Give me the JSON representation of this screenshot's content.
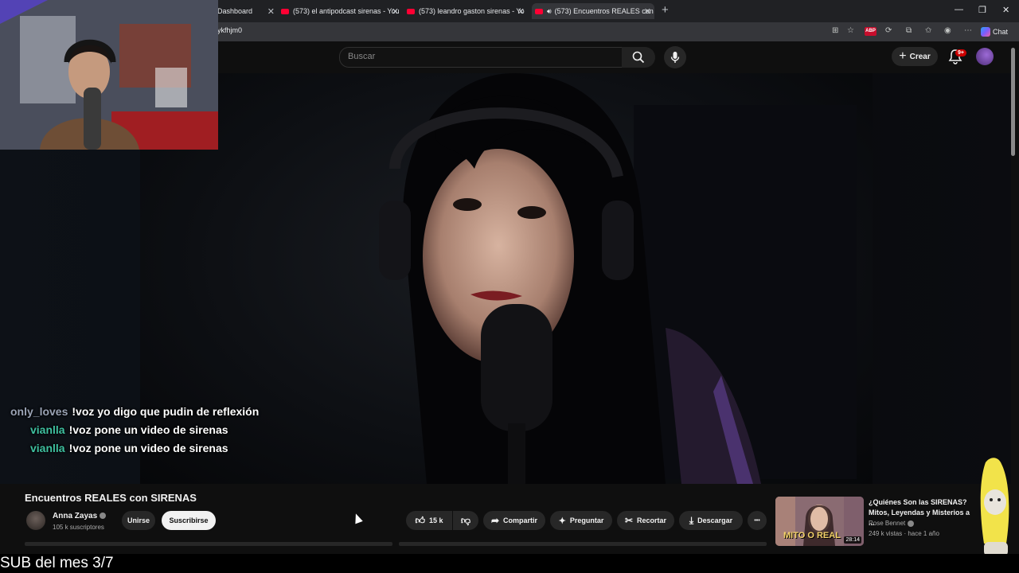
{
  "browser": {
    "tabs": [
      {
        "title": "Dashboard"
      },
      {
        "title": "(573) el antipodcast sirenas - YouT"
      },
      {
        "title": "(573) leandro gaston sirenas - You"
      },
      {
        "title": "(573) Encuentros REALES con"
      }
    ],
    "new_tab_icon": "plus-icon",
    "address": "ykfhjm0",
    "extension_badge": "ABP",
    "chat_label": "Chat",
    "window_controls": {
      "minimize": "—",
      "restore": "❐",
      "close": "✕"
    }
  },
  "youtube": {
    "search_placeholder": "Buscar",
    "create_label": "Crear",
    "notifications_badge": "9+",
    "video": {
      "title": "Encuentros REALES con SIRENAS",
      "channel": "Anna Zayas",
      "subscribers": "105 k suscriptores",
      "join_label": "Unirse",
      "subscribe_label": "Suscribirse",
      "likes": "15 k",
      "share_label": "Compartir",
      "ask_label": "Preguntar",
      "clip_label": "Recortar",
      "download_label": "Descargar",
      "more_icon": "•••"
    },
    "recommended": {
      "title": "¿Quiénes Son las SIRENAS? Mitos, Leyendas y Misterios a ...",
      "channel": "Rose Bennet",
      "meta": "249 k vistas · hace 1 año",
      "duration": "28:14",
      "thumb_text": "MITO O REAL"
    }
  },
  "stream_chat": [
    {
      "user": "only_loves",
      "message": "!voz yo digo que pudin de reflexión",
      "user_color": "#9aa3b5"
    },
    {
      "user": "vianlla",
      "message": "!voz pone un video de sirenas",
      "user_color": "#3fc0a0"
    },
    {
      "user": "vianlla",
      "message": "!voz pone un video de sirenas",
      "user_color": "#3fc0a0"
    }
  ],
  "overlay_footer": "SUB del mes 3/7",
  "colors": {
    "accent": "#ff0033",
    "background": "#0f0f0f",
    "pill": "#272727"
  }
}
